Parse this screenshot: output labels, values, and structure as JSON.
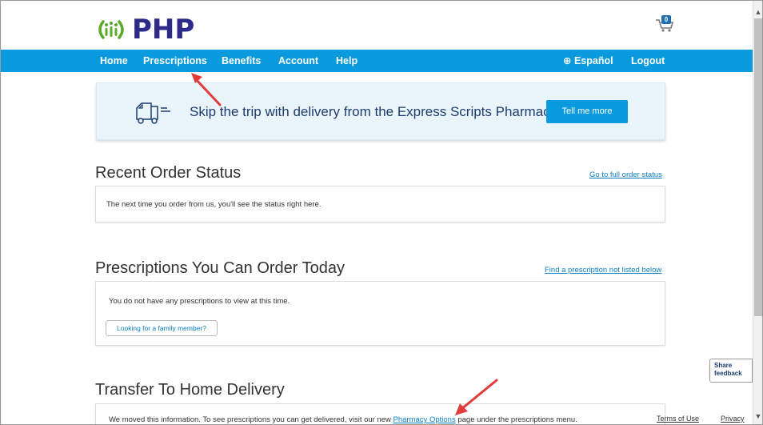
{
  "brand": {
    "name": "PHP"
  },
  "cart": {
    "count": "0"
  },
  "nav": {
    "items": [
      {
        "label": "Home"
      },
      {
        "label": "Prescriptions"
      },
      {
        "label": "Benefits"
      },
      {
        "label": "Account"
      },
      {
        "label": "Help"
      }
    ],
    "language": "⊕ Español",
    "logout": "Logout"
  },
  "banner": {
    "text": "Skip the trip with delivery from the Express Scripts Pharmacy.",
    "button": "Tell me more"
  },
  "recent_orders": {
    "title": "Recent Order Status",
    "link": "Go to full order status",
    "message": "The next time you order from us, you'll see the status right here."
  },
  "prescriptions": {
    "title": "Prescriptions You Can Order Today",
    "link": "Find a prescription not listed below",
    "message": "You do not have any prescriptions to view at this time.",
    "family_button": "Looking for a family member?"
  },
  "transfer": {
    "title": "Transfer To Home Delivery",
    "message_before": "We moved this information. To see prescriptions you can get delivered, visit our new ",
    "message_link": "Pharmacy Options",
    "message_after": " page under the prescriptions menu."
  },
  "feedback": {
    "line1": "Share",
    "line2": "feedback"
  },
  "footer": {
    "terms": "Terms of Use",
    "privacy": "Privacy"
  },
  "colors": {
    "nav": "#0a9ade",
    "brand": "#2d2a8a",
    "accent_green": "#5aaa2a",
    "arrow": "#e03c3c"
  }
}
